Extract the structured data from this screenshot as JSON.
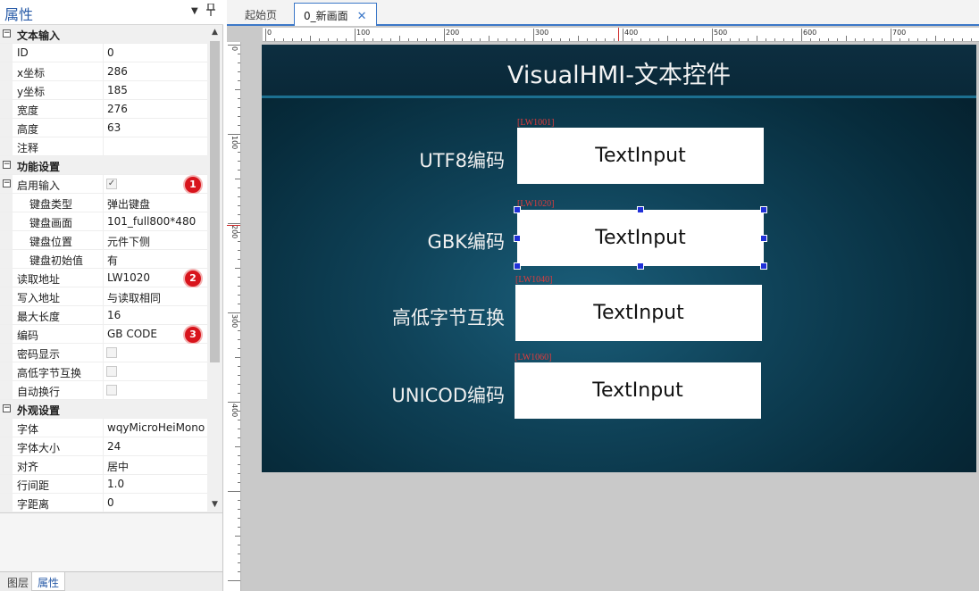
{
  "panel": {
    "title": "属性",
    "dropdown_icon": "▼",
    "pin_icon": "📌"
  },
  "properties": [
    {
      "type": "category",
      "name": "文本输入",
      "toggle": "−"
    },
    {
      "type": "prop",
      "name": "ID",
      "value": "0"
    },
    {
      "type": "prop",
      "name": "x坐标",
      "value": "286"
    },
    {
      "type": "prop",
      "name": "y坐标",
      "value": "185"
    },
    {
      "type": "prop",
      "name": "宽度",
      "value": "276"
    },
    {
      "type": "prop",
      "name": "高度",
      "value": "63"
    },
    {
      "type": "prop",
      "name": "注释",
      "value": ""
    },
    {
      "type": "category",
      "name": "功能设置",
      "toggle": "−"
    },
    {
      "type": "prop",
      "name": "启用输入",
      "checkbox": true,
      "checked": true,
      "badge": "1",
      "toggle": "−"
    },
    {
      "type": "sub",
      "name": "键盘类型",
      "value": "弹出键盘"
    },
    {
      "type": "sub",
      "name": "键盘画面",
      "value": "101_full800*480"
    },
    {
      "type": "sub",
      "name": "键盘位置",
      "value": "元件下侧"
    },
    {
      "type": "sub",
      "name": "键盘初始值",
      "value": "有"
    },
    {
      "type": "prop",
      "name": "读取地址",
      "value": "LW1020",
      "badge": "2"
    },
    {
      "type": "prop",
      "name": "写入地址",
      "value": "与读取相同"
    },
    {
      "type": "prop",
      "name": "最大长度",
      "value": "16"
    },
    {
      "type": "prop",
      "name": "编码",
      "value": "GB CODE",
      "badge": "3"
    },
    {
      "type": "prop",
      "name": "密码显示",
      "checkbox": true,
      "checked": false
    },
    {
      "type": "prop",
      "name": "高低字节互换",
      "checkbox": true,
      "checked": false
    },
    {
      "type": "prop",
      "name": "自动换行",
      "checkbox": true,
      "checked": false
    },
    {
      "type": "category",
      "name": "外观设置",
      "toggle": "−"
    },
    {
      "type": "prop",
      "name": "字体",
      "value": "wqyMicroHeiMono"
    },
    {
      "type": "prop",
      "name": "字体大小",
      "value": "24"
    },
    {
      "type": "prop",
      "name": "对齐",
      "value": "居中"
    },
    {
      "type": "prop",
      "name": "行间距",
      "value": "1.0"
    },
    {
      "type": "prop",
      "name": "字距离",
      "value": "0"
    }
  ],
  "bottom_tabs": [
    {
      "label": "图层",
      "active": false
    },
    {
      "label": "属性",
      "active": true
    }
  ],
  "doc_tabs": [
    {
      "label": "起始页",
      "active": false
    },
    {
      "label": "0_新画面",
      "active": true,
      "close": "✕"
    }
  ],
  "ruler": {
    "h_labels": [
      "0",
      "100",
      "200",
      "300",
      "400",
      "500",
      "600",
      "700"
    ],
    "v_labels": [
      "0",
      "100",
      "200",
      "300",
      "400"
    ]
  },
  "screen": {
    "title": "VisualHMI-文本控件",
    "rows": [
      {
        "label": "UTF8编码",
        "address": "[LW1001]",
        "input_text": "TextInput",
        "selected": false
      },
      {
        "label": "GBK编码",
        "address": "[LW1020]",
        "input_text": "TextInput",
        "selected": true
      },
      {
        "label": "高低字节互换",
        "address": "[LW1040]",
        "input_text": "TextInput",
        "selected": false
      },
      {
        "label": "UNICOD编码",
        "address": "[LW1060]",
        "input_text": "TextInput",
        "selected": false
      }
    ]
  }
}
